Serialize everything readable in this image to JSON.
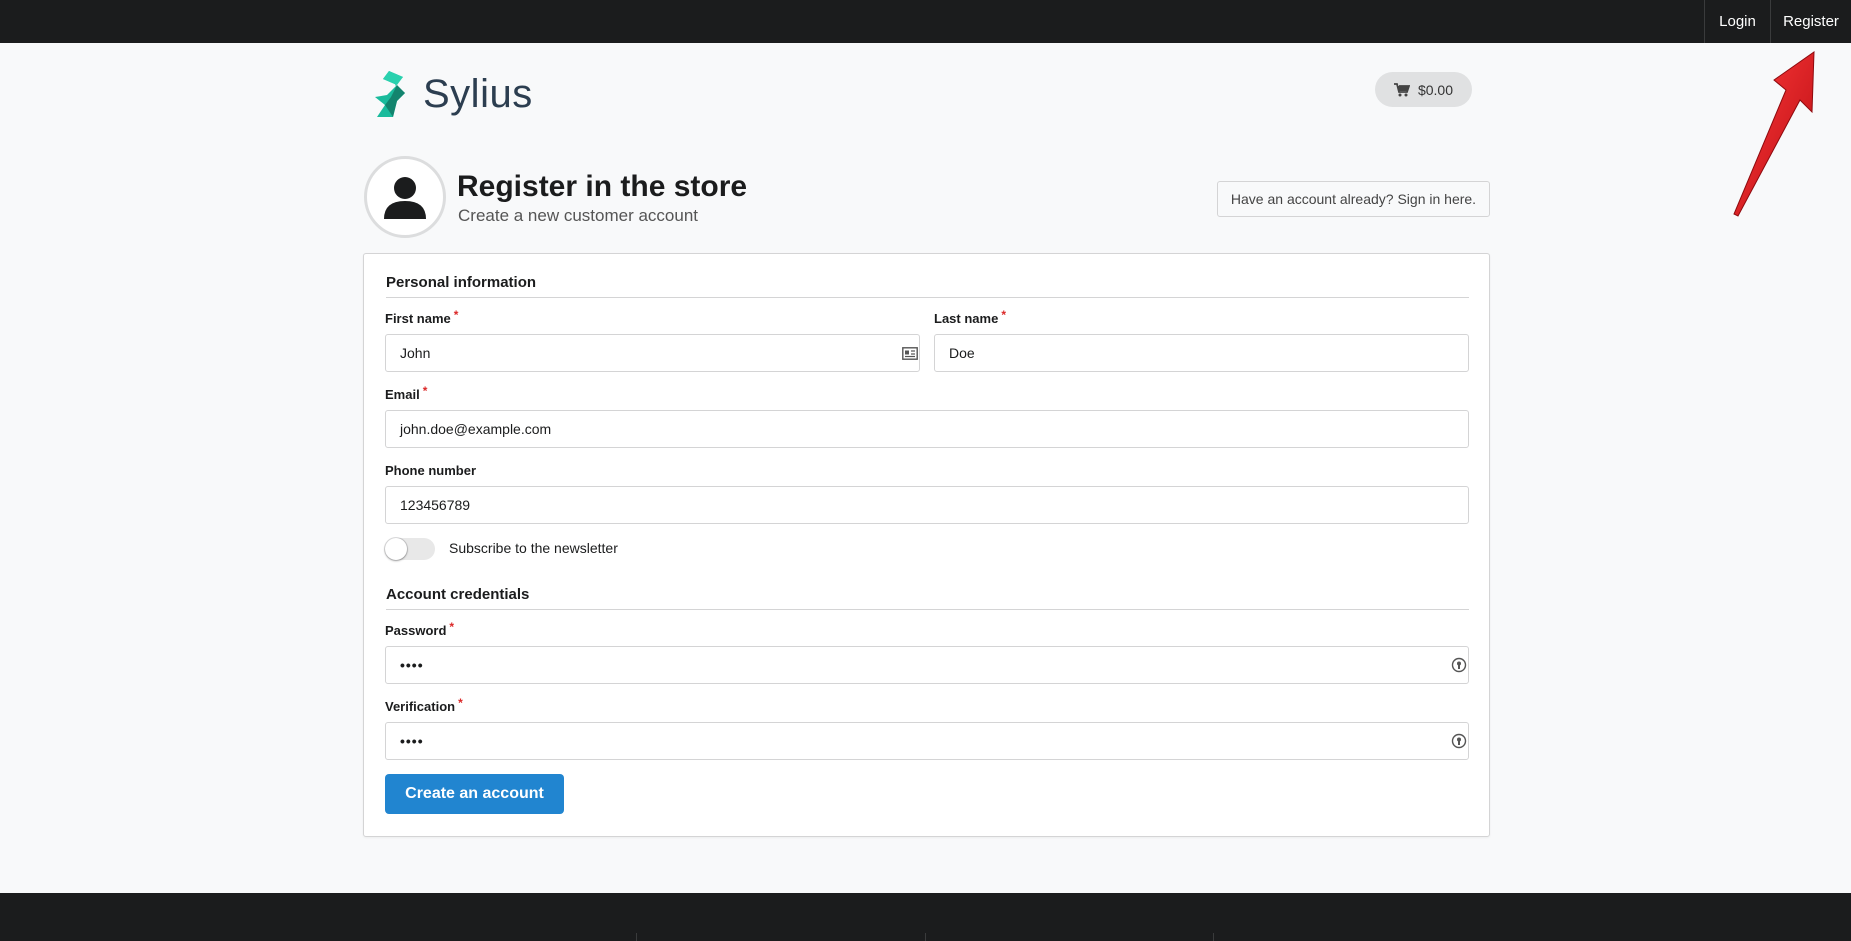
{
  "topbar": {
    "login_label": "Login",
    "register_label": "Register"
  },
  "header": {
    "logo_text": "Sylius",
    "cart_total": "$0.00"
  },
  "page": {
    "title": "Register in the store",
    "subtitle": "Create a new customer account",
    "signin_link": "Have an account already? Sign in here."
  },
  "form": {
    "personal_section": "Personal information",
    "first_name": {
      "label": "First name",
      "required": "*",
      "value": "John"
    },
    "last_name": {
      "label": "Last name",
      "required": "*",
      "value": "Doe"
    },
    "email": {
      "label": "Email",
      "required": "*",
      "value": "john.doe@example.com"
    },
    "phone": {
      "label": "Phone number",
      "value": "123456789"
    },
    "newsletter": {
      "label": "Subscribe to the newsletter",
      "checked": false
    },
    "credentials_section": "Account credentials",
    "password": {
      "label": "Password",
      "required": "*",
      "value": "••••"
    },
    "verification": {
      "label": "Verification",
      "required": "*",
      "value": "••••"
    },
    "submit_label": "Create an account"
  },
  "colors": {
    "topbar": "#1b1c1d",
    "primary": "#2185d0",
    "required": "#db2828",
    "logo_teal": "#1abb9c",
    "annotation_arrow": "#e3131b"
  }
}
